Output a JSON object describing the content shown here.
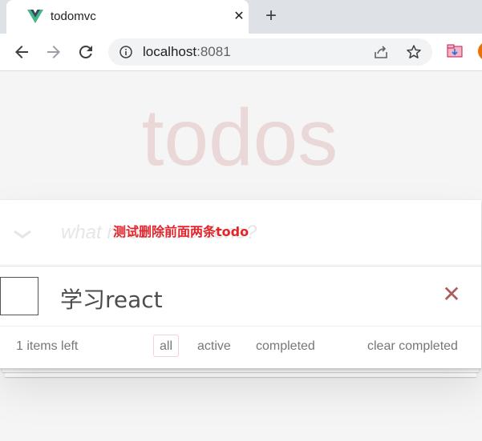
{
  "browser": {
    "tab_title": "todomvc",
    "tab_close": "✕",
    "new_tab": "+",
    "url_host": "localhost",
    "url_port": ":8081"
  },
  "app": {
    "title": "todos",
    "new_todo_placeholder": "what need to be done?",
    "annotation": "测试删除前面两条todo",
    "todos": [
      {
        "title": "学习react",
        "completed": false
      }
    ],
    "destroy_label": "✕",
    "footer": {
      "items_left": "1 items left",
      "filters": [
        "all",
        "active",
        "completed"
      ],
      "selected_filter": "all",
      "clear_completed": "clear completed"
    }
  },
  "colors": {
    "title": "#af2f2f",
    "annotation": "#e3242b",
    "destroy": "#af5b5e",
    "vue_green": "#41b883",
    "vue_dark": "#34495e"
  },
  "icons": [
    "vue-logo-icon",
    "close-icon",
    "plus-icon",
    "back-arrow-icon",
    "forward-arrow-icon",
    "reload-icon",
    "info-icon",
    "share-icon",
    "star-icon",
    "extension-icon",
    "chevron-down-icon"
  ]
}
